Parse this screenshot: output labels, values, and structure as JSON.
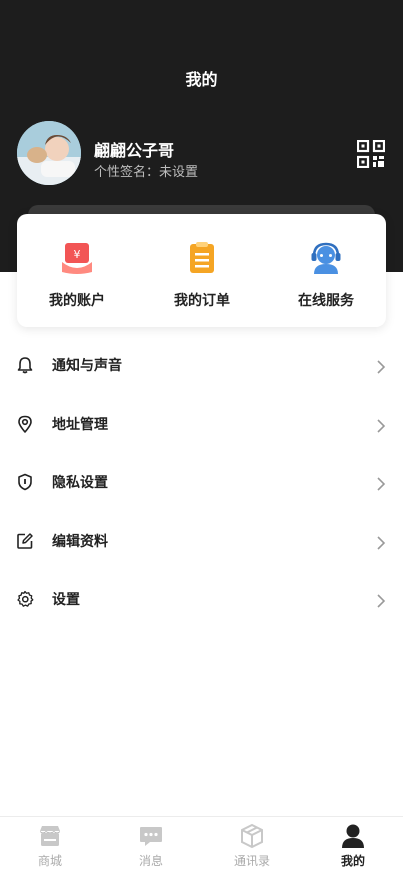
{
  "header": {
    "title": "我的",
    "username": "翩翩公子哥",
    "signature": "个性签名：未设置"
  },
  "quick_actions": [
    {
      "label": "我的账户",
      "icon": "wallet-icon",
      "color": "#f25555"
    },
    {
      "label": "我的订单",
      "icon": "clipboard-icon",
      "color": "#f5a524"
    },
    {
      "label": "在线服务",
      "icon": "customer-service-icon",
      "color": "#4a90e2"
    }
  ],
  "menu": [
    {
      "label": "通知与声音",
      "icon": "bell-icon"
    },
    {
      "label": "地址管理",
      "icon": "location-pin-icon"
    },
    {
      "label": "隐私设置",
      "icon": "shield-icon"
    },
    {
      "label": "编辑资料",
      "icon": "edit-icon"
    },
    {
      "label": "设置",
      "icon": "gear-icon"
    }
  ],
  "tabbar": [
    {
      "label": "商城",
      "icon": "shop-icon",
      "active": false
    },
    {
      "label": "消息",
      "icon": "message-icon",
      "active": false
    },
    {
      "label": "通讯录",
      "icon": "contacts-icon",
      "active": false
    },
    {
      "label": "我的",
      "icon": "user-icon",
      "active": true
    }
  ],
  "colors": {
    "header_bg": "#1d1d1d",
    "active_tab": "#222222",
    "inactive_tab": "#aaaaaa"
  }
}
